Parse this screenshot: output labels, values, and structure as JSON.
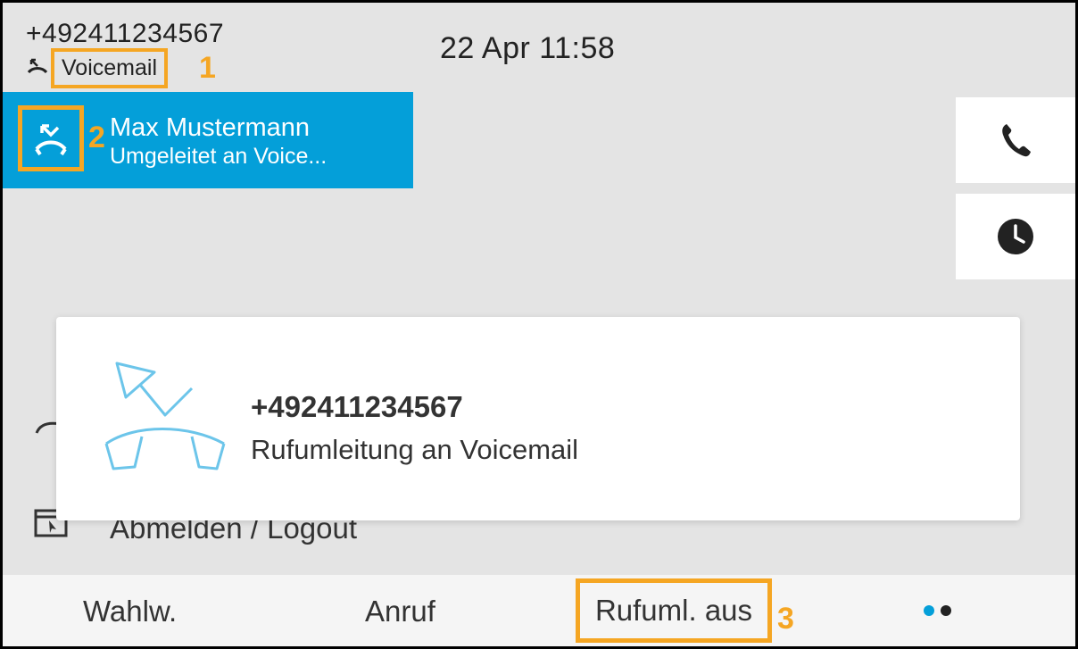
{
  "header": {
    "number": "+492411234567",
    "status_label": "Voicemail",
    "clock": "22 Apr 11:58"
  },
  "markers": [
    "1",
    "2",
    "3"
  ],
  "line": {
    "name": "Max Mustermann",
    "subtitle": "Umgeleitet an Voice..."
  },
  "side_buttons": {
    "call_icon": "phone-handset-icon",
    "recents_icon": "clock-icon"
  },
  "background_list": {
    "logout_label": "Abmelden / Logout"
  },
  "popup": {
    "title": "+492411234567",
    "subtitle": "Rufumleitung an Voicemail",
    "icon": "forward-to-voicemail-icon"
  },
  "softkeys": {
    "redial": "Wahlw.",
    "call": "Anruf",
    "forward_off": "Rufuml. aus",
    "page_dots": [
      "active",
      "inactive"
    ]
  },
  "colors": {
    "accent_blue": "#049fd9",
    "highlight_orange": "#f5a623",
    "icon_light_blue": "#6cc5ea"
  }
}
